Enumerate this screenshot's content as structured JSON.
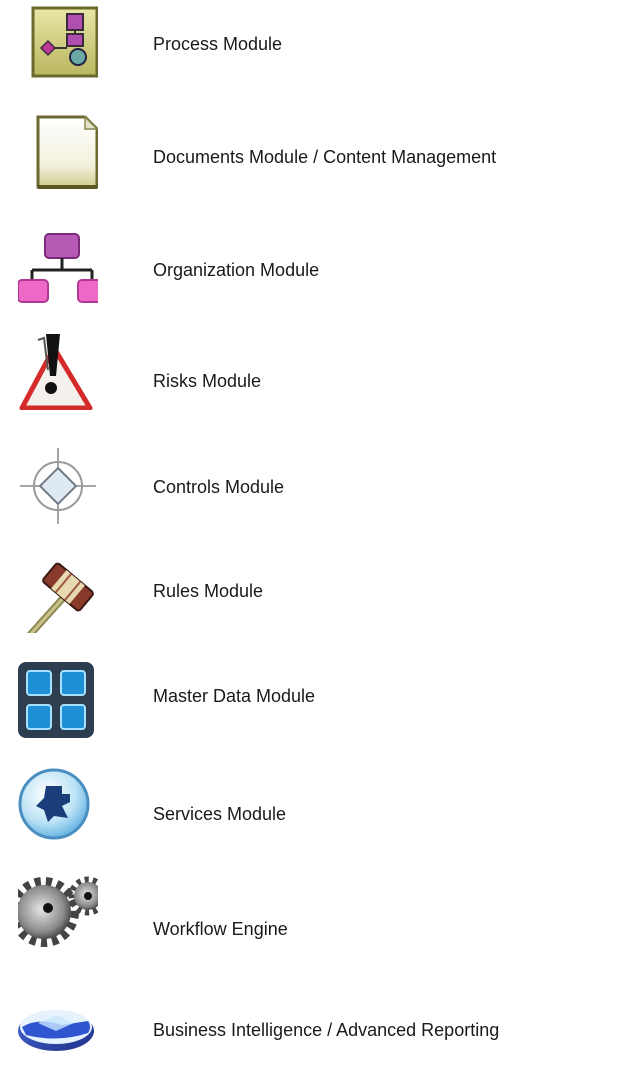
{
  "modules": [
    {
      "label": "Process Module",
      "icon": "process-diagram-icon"
    },
    {
      "label": "Documents Module / Content Management",
      "icon": "document-icon"
    },
    {
      "label": "Organization Module",
      "icon": "org-chart-icon"
    },
    {
      "label": "Risks Module",
      "icon": "warning-triangle-icon"
    },
    {
      "label": "Controls Module",
      "icon": "crosshair-target-icon"
    },
    {
      "label": "Rules Module",
      "icon": "gavel-icon"
    },
    {
      "label": "Master Data Module",
      "icon": "grid-squares-icon"
    },
    {
      "label": "Services Module",
      "icon": "puzzle-globe-icon"
    },
    {
      "label": "Workflow Engine",
      "icon": "gears-icon"
    },
    {
      "label": "Business Intelligence / Advanced Reporting",
      "icon": "bi-disk-icon"
    }
  ]
}
